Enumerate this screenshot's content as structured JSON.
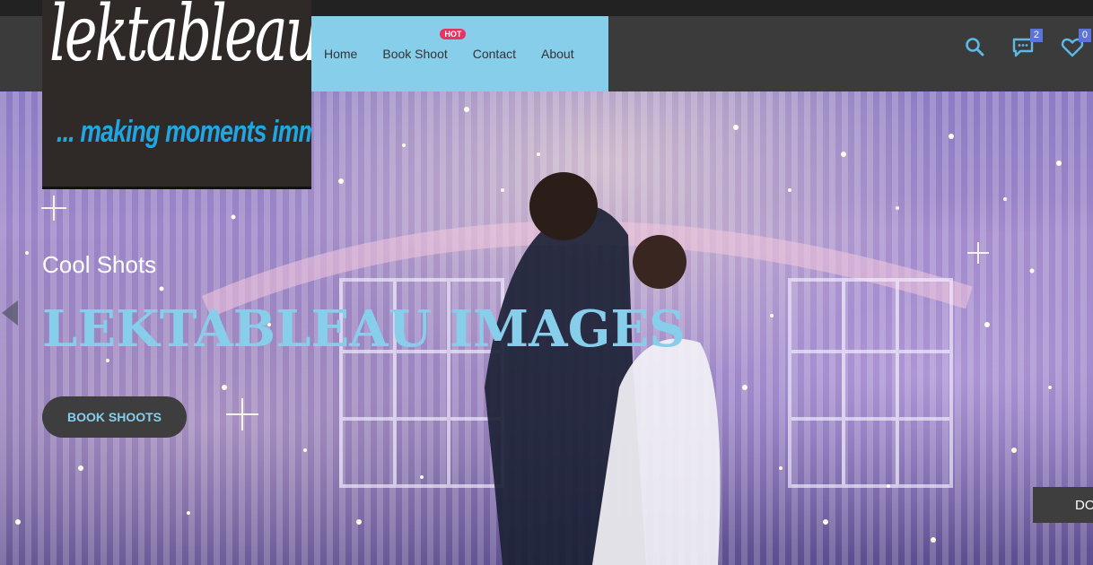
{
  "logo": {
    "main_text": "lektableau",
    "tagline": "... making moments immortal"
  },
  "nav": {
    "items": [
      {
        "label": "Home"
      },
      {
        "label": "Book Shoot",
        "badge": "HOT"
      },
      {
        "label": "Contact"
      },
      {
        "label": "About"
      }
    ]
  },
  "header_icons": {
    "search_icon": "search-icon",
    "chat_icon": "chat-bubble-icon",
    "chat_count": "2",
    "heart_icon": "heart-icon",
    "wishlist_count": "0"
  },
  "hero": {
    "subtitle": "Cool Shots",
    "title": "LEKTABLEAU IMAGES",
    "button_label": "BOOK SHOOTS",
    "side_tab_label": "DO"
  },
  "colors": {
    "accent": "#87ceeb",
    "hot_badge": "#e8325f",
    "header_bg": "#3b3b3b",
    "count_badge": "#5b74d6"
  }
}
